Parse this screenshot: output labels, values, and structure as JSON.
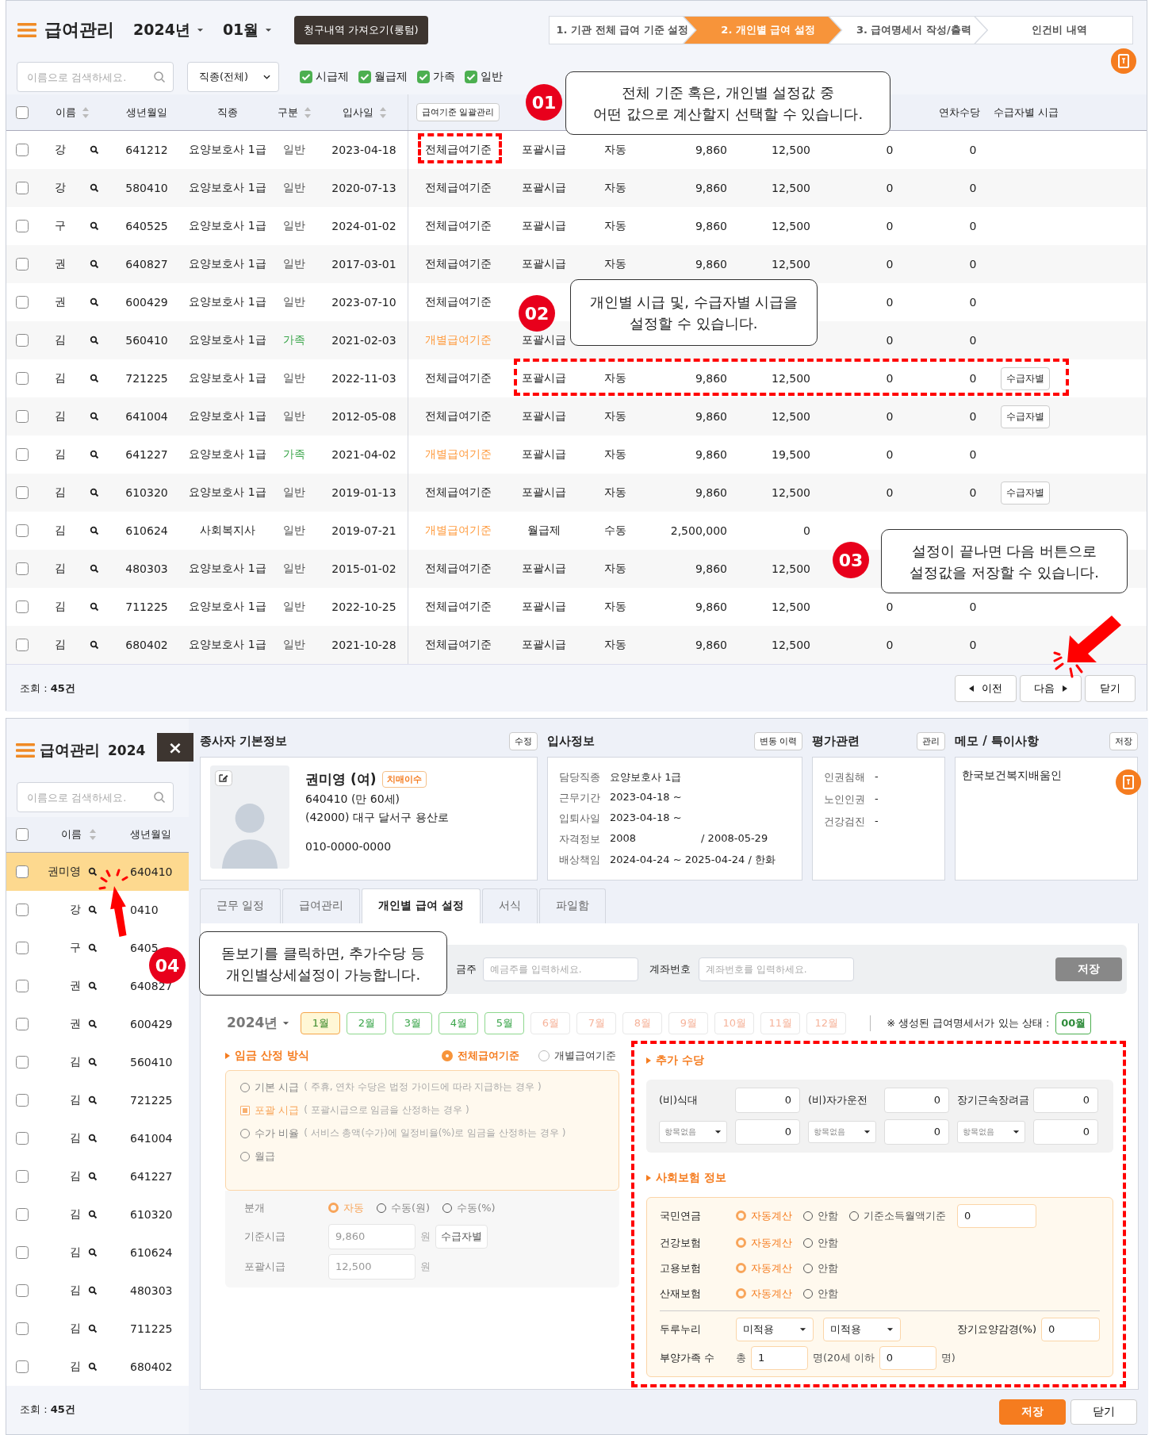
{
  "top": {
    "app_title": "급여관리",
    "year": "2024년",
    "month": "01월",
    "import_button": "청구내역 가져오기(롱텀)",
    "steps": [
      {
        "label": "1. 기관 전체 급여 기준 설정",
        "selected": false
      },
      {
        "label": "2. 개인별 급여 설정",
        "selected": true
      },
      {
        "label": "3. 급여명세서 작성/출력",
        "selected": false
      },
      {
        "label": "인건비 내역",
        "selected": false
      }
    ],
    "search": {
      "placeholder": "이름으로 검색하세요."
    },
    "job_select": "직종(전체)",
    "filters": [
      {
        "label": "시급제",
        "checked": true
      },
      {
        "label": "월급제",
        "checked": true
      },
      {
        "label": "가족",
        "checked": true
      },
      {
        "label": "일반",
        "checked": true
      }
    ],
    "select_all_checked": false,
    "columns": [
      {
        "kind": "text",
        "label": "이름",
        "sortable": true
      },
      {
        "kind": "text",
        "label": "생년월일"
      },
      {
        "kind": "text",
        "label": "직종"
      },
      {
        "kind": "text",
        "label": "구분",
        "sortable": true
      },
      {
        "kind": "text",
        "label": "입사일",
        "sortable": true
      },
      {
        "kind": "button",
        "label": "급여기준 일괄관리"
      },
      {
        "kind": "hidden"
      },
      {
        "kind": "hidden"
      },
      {
        "kind": "hidden"
      },
      {
        "kind": "hidden"
      },
      {
        "kind": "hidden"
      },
      {
        "kind": "text",
        "label": "연차수당"
      },
      {
        "kind": "text",
        "label": "수급자별 시급"
      }
    ],
    "rows": [
      {
        "checked": false,
        "name": "강",
        "birth": "641212",
        "job": "요양보호사 1급",
        "type": {
          "text": "일반",
          "color": "#555555"
        },
        "hired": "2023-04-18",
        "basis": {
          "text": "전체급여기준",
          "color": "#222222"
        },
        "method": "포괄시급",
        "mode": "자동",
        "column_10": "9,860",
        "column_11": "12,500",
        "column_12": "0",
        "annual_leave": "0"
      },
      {
        "checked": false,
        "name": "강",
        "birth": "580410",
        "job": "요양보호사 1급",
        "type": {
          "text": "일반",
          "color": "#555555"
        },
        "hired": "2020-07-13",
        "basis": {
          "text": "전체급여기준",
          "color": "#222222"
        },
        "method": "포괄시급",
        "mode": "자동",
        "column_10": "9,860",
        "column_11": "12,500",
        "column_12": "0",
        "annual_leave": "0"
      },
      {
        "checked": false,
        "name": "구",
        "birth": "640525",
        "job": "요양보호사 1급",
        "type": {
          "text": "일반",
          "color": "#555555"
        },
        "hired": "2024-01-02",
        "basis": {
          "text": "전체급여기준",
          "color": "#222222"
        },
        "method": "포괄시급",
        "mode": "자동",
        "column_10": "9,860",
        "column_11": "12,500",
        "column_12": "0",
        "annual_leave": "0"
      },
      {
        "checked": false,
        "name": "권",
        "birth": "640827",
        "job": "요양보호사 1급",
        "type": {
          "text": "일반",
          "color": "#555555"
        },
        "hired": "2017-03-01",
        "basis": {
          "text": "전체급여기준",
          "color": "#222222"
        },
        "method": "포괄시급",
        "mode": "자동",
        "column_10": "9,860",
        "column_11": "12,500",
        "column_12": "0",
        "annual_leave": "0"
      },
      {
        "checked": false,
        "name": "권",
        "birth": "600429",
        "job": "요양보호사 1급",
        "type": {
          "text": "일반",
          "color": "#555555"
        },
        "hired": "2023-07-10",
        "basis": {
          "text": "전체급여기준",
          "color": "#222222"
        },
        "column_12": "0",
        "annual_leave": "0"
      },
      {
        "checked": false,
        "name": "김",
        "birth": "560410",
        "job": "요양보호사 1급",
        "type": {
          "text": "가족",
          "color": "#3aa54a"
        },
        "hired": "2021-02-03",
        "basis": {
          "text": "개별급여기준",
          "color": "#ff9a3c"
        },
        "method": "포괄시급",
        "column_12": "0",
        "annual_leave": "0"
      },
      {
        "checked": false,
        "name": "김",
        "birth": "721225",
        "job": "요양보호사 1급",
        "type": {
          "text": "일반",
          "color": "#555555"
        },
        "hired": "2022-11-03",
        "basis": {
          "text": "전체급여기준",
          "color": "#222222"
        },
        "method": "포괄시급",
        "mode": "자동",
        "column_10": "9,860",
        "column_11": "12,500",
        "column_12": "0",
        "annual_leave": "0",
        "rate_button": "수급자별"
      },
      {
        "checked": false,
        "name": "김",
        "birth": "641004",
        "job": "요양보호사 1급",
        "type": {
          "text": "일반",
          "color": "#555555"
        },
        "hired": "2012-05-08",
        "basis": {
          "text": "전체급여기준",
          "color": "#222222"
        },
        "method": "포괄시급",
        "mode": "자동",
        "column_10": "9,860",
        "column_11": "12,500",
        "column_12": "0",
        "annual_leave": "0",
        "rate_button": "수급자별"
      },
      {
        "checked": false,
        "name": "김",
        "birth": "641227",
        "job": "요양보호사 1급",
        "type": {
          "text": "가족",
          "color": "#3aa54a"
        },
        "hired": "2021-04-02",
        "basis": {
          "text": "개별급여기준",
          "color": "#ff9a3c"
        },
        "method": "포괄시급",
        "mode": "자동",
        "column_10": "9,860",
        "column_11": "19,500",
        "column_12": "0",
        "annual_leave": "0"
      },
      {
        "checked": false,
        "name": "김",
        "birth": "610320",
        "job": "요양보호사 1급",
        "type": {
          "text": "일반",
          "color": "#555555"
        },
        "hired": "2019-01-13",
        "basis": {
          "text": "전체급여기준",
          "color": "#222222"
        },
        "method": "포괄시급",
        "mode": "자동",
        "column_10": "9,860",
        "column_11": "12,500",
        "column_12": "0",
        "annual_leave": "0",
        "rate_button": "수급자별"
      },
      {
        "checked": false,
        "name": "김",
        "birth": "610624",
        "job": "사회복지사",
        "type": {
          "text": "일반",
          "color": "#555555"
        },
        "hired": "2019-07-21",
        "basis": {
          "text": "개별급여기준",
          "color": "#ff9a3c"
        },
        "method": "월급제",
        "mode": "수동",
        "column_10": "2,500,000",
        "column_11": "0"
      },
      {
        "checked": false,
        "name": "김",
        "birth": "480303",
        "job": "요양보호사 1급",
        "type": {
          "text": "일반",
          "color": "#555555"
        },
        "hired": "2015-01-02",
        "basis": {
          "text": "전체급여기준",
          "color": "#222222"
        },
        "method": "포괄시급",
        "mode": "자동",
        "column_10": "9,860",
        "column_11": "12,500"
      },
      {
        "checked": false,
        "name": "김",
        "birth": "711225",
        "job": "요양보호사 1급",
        "type": {
          "text": "일반",
          "color": "#555555"
        },
        "hired": "2022-10-25",
        "basis": {
          "text": "전체급여기준",
          "color": "#222222"
        },
        "method": "포괄시급",
        "mode": "자동",
        "column_10": "9,860",
        "column_11": "12,500",
        "column_12": "0",
        "annual_leave": "0"
      },
      {
        "checked": false,
        "name": "김",
        "birth": "680402",
        "job": "요양보호사 1급",
        "type": {
          "text": "일반",
          "color": "#555555"
        },
        "hired": "2021-10-28",
        "basis": {
          "text": "전체급여기준",
          "color": "#222222"
        },
        "method": "포괄시급",
        "mode": "자동",
        "column_10": "9,860",
        "column_11": "12,500",
        "column_12": "0",
        "annual_leave": "0"
      }
    ],
    "count": "조회 : **45건**",
    "buttons": [
      {
        "label": "이전",
        "kind": "prev"
      },
      {
        "label": "다음",
        "kind": "next"
      },
      {
        "label": "닫기",
        "kind": "plain"
      }
    ]
  },
  "detail": {
    "sidebar": {
      "app_title": "급여관리",
      "year": "2024",
      "search": {
        "placeholder": "이름으로 검색하세요."
      },
      "select_all_checked": false,
      "columns": [
        {
          "label": "이름",
          "sortable": true
        },
        {
          "label": "생년월일"
        }
      ],
      "rows": [
        {
          "name": "권미영",
          "birth": "640410",
          "selected": true,
          "checked": false
        },
        {
          "name": "강",
          "birth": "0410",
          "selected": false,
          "checked": false
        },
        {
          "name": "구",
          "birth": "6405",
          "selected": false,
          "checked": false
        },
        {
          "name": "권",
          "birth": "640827",
          "selected": false,
          "checked": false
        },
        {
          "name": "권",
          "birth": "600429",
          "selected": false,
          "checked": false
        },
        {
          "name": "김",
          "birth": "560410",
          "selected": false,
          "checked": false
        },
        {
          "name": "김",
          "birth": "721225",
          "selected": false,
          "checked": false
        },
        {
          "name": "김",
          "birth": "641004",
          "selected": false,
          "checked": false
        },
        {
          "name": "김",
          "birth": "641227",
          "selected": false,
          "checked": false
        },
        {
          "name": "김",
          "birth": "610320",
          "selected": false,
          "checked": false
        },
        {
          "name": "김",
          "birth": "610624",
          "selected": false,
          "checked": false
        },
        {
          "name": "김",
          "birth": "480303",
          "selected": false,
          "checked": false
        },
        {
          "name": "김",
          "birth": "711225",
          "selected": false,
          "checked": false
        },
        {
          "name": "김",
          "birth": "680402",
          "selected": false,
          "checked": false
        }
      ],
      "count": "조회 : **45건**"
    },
    "close_button": "×",
    "sections": [
      {
        "title": "종사자 기본정보",
        "button": "수정"
      },
      {
        "title": "입사정보",
        "button": "변동 이력"
      },
      {
        "title": "평가관련",
        "button": "관리"
      },
      {
        "title": "메모 / 특이사항",
        "button": "저장"
      }
    ],
    "profile": {
      "name": "권미영 (여)",
      "badge": "치매이수",
      "birth": "640410 (만 60세)",
      "address": "(42000) 대구 달서구 용산로",
      "phone": "010-0000-0000"
    },
    "employment": [
      {
        "label": "담당직종",
        "values": [
          "요양보호사 1급"
        ]
      },
      {
        "label": "근무기간",
        "values": [
          "2023-04-18 ~"
        ]
      },
      {
        "label": "입퇴사일",
        "values": [
          "2023-04-18 ~"
        ]
      },
      {
        "label": "자격정보",
        "values": [
          "2008",
          "/ 2008-05-29"
        ]
      },
      {
        "label": "배상책임",
        "values": [
          "2024-04-24 ~ 2025-04-24 / 한화"
        ]
      }
    ],
    "evaluation": [
      {
        "label": "인권침해",
        "value": "-"
      },
      {
        "label": "노인인권",
        "value": "-"
      },
      {
        "label": "건강검진",
        "value": "-"
      }
    ],
    "memo": "한국보건복지배움인",
    "tabs": [
      {
        "label": "근무 일정",
        "selected": false
      },
      {
        "label": "급여관리",
        "selected": false
      },
      {
        "label": "개인별 급여 설정",
        "selected": true
      },
      {
        "label": "서식",
        "selected": false
      },
      {
        "label": "파일함",
        "selected": false
      }
    ],
    "bank": {
      "holder_label": "금주",
      "holder_placeholder": "예금주를 입력하세요.",
      "account_label": "계좌번호",
      "account_placeholder": "계좌번호를 입력하세요.",
      "save_button": "저장"
    },
    "year": "2024년",
    "months": [
      {
        "label": "1월",
        "selected": true,
        "generated": true
      },
      {
        "label": "2월",
        "selected": false,
        "generated": true
      },
      {
        "label": "3월",
        "selected": false,
        "generated": true
      },
      {
        "label": "4월",
        "selected": false,
        "generated": true
      },
      {
        "label": "5월",
        "selected": false,
        "generated": true
      },
      {
        "label": "6월",
        "selected": false,
        "generated": false
      },
      {
        "label": "7월",
        "selected": false,
        "generated": false
      },
      {
        "label": "8월",
        "selected": false,
        "generated": false
      },
      {
        "label": "9월",
        "selected": false,
        "generated": false
      },
      {
        "label": "10월",
        "selected": false,
        "generated": false
      },
      {
        "label": "11월",
        "selected": false,
        "generated": false
      },
      {
        "label": "12월",
        "selected": false,
        "generated": false
      }
    ],
    "status_label": "※ 생성된 급여명세서가 있는 상태 :",
    "status_value": "00월",
    "wage": {
      "title": "임금 산정 방식",
      "basis": [
        {
          "label": "전체급여기준",
          "selected": true
        },
        {
          "label": "개별급여기준",
          "selected": false
        }
      ],
      "methods": [
        {
          "label": "기본 시급",
          "note": "( 주휴, 연차 수당은 법정 가이드에 따라 지급하는 경우 )",
          "selected": false
        },
        {
          "label": "포괄 시급",
          "note": "( 포괄시급으로 임금을 산정하는 경우 )",
          "selected": true
        },
        {
          "label": "수가 비율",
          "note": "( 서비스 총액(수가)에 일정비율(%)로 임금을 산정하는 경우 )",
          "selected": false
        },
        {
          "label": "월급",
          "selected": false
        }
      ],
      "split_label": "분개",
      "split_options": [
        {
          "label": "자동",
          "selected": true
        },
        {
          "label": "수동(원)",
          "selected": false
        },
        {
          "label": "수동(%)",
          "selected": false
        }
      ],
      "base_label": "기준시급",
      "base_value": "9,860",
      "base_unit": "원",
      "rate_button": "수급자별",
      "inclusive_label": "포괄시급",
      "inclusive_value": "12,500",
      "inclusive_unit": "원"
    },
    "allowances": {
      "title": "추가 수당",
      "fixed": [
        {
          "label": "(비)식대",
          "value": "0"
        },
        {
          "label": "(비)자가운전",
          "value": "0"
        },
        {
          "label": "장기근속장려금",
          "value": "0"
        }
      ],
      "custom": [
        {
          "select": "항목없음",
          "value": "0"
        },
        {
          "select": "항목없음",
          "value": "0"
        },
        {
          "select": "항목없음",
          "value": "0"
        }
      ]
    },
    "insurance": {
      "title": "사회보험 정보",
      "rows": [
        {
          "label": "국민연금",
          "options": [
            {
              "label": "자동계산",
              "selected": true
            },
            {
              "label": "안함",
              "selected": false
            },
            {
              "label": "기준소득월액기준",
              "selected": false
            }
          ],
          "value": "0"
        },
        {
          "label": "건강보험",
          "options": [
            {
              "label": "자동계산",
              "selected": true
            },
            {
              "label": "안함",
              "selected": false
            }
          ]
        },
        {
          "label": "고용보험",
          "options": [
            {
              "label": "자동계산",
              "selected": true
            },
            {
              "label": "안함",
              "selected": false
            }
          ]
        },
        {
          "label": "산재보험",
          "options": [
            {
              "label": "자동계산",
              "selected": true
            },
            {
              "label": "안함",
              "selected": false
            }
          ]
        }
      ],
      "durunuri_label": "두루누리",
      "durunuri_selects": [
        "미적용",
        "미적용"
      ],
      "ltc_label": "장기요양감경(%)",
      "ltc_value": "0",
      "dependents_label": "부양가족 수",
      "total_label": "총",
      "total_value": "1",
      "under20_label": "명(20세 이하",
      "under20_value": "0",
      "end_label": "명)"
    },
    "footer_buttons": [
      {
        "label": "저장",
        "kind": "primary"
      },
      {
        "label": "닫기",
        "kind": "plain"
      }
    ]
  },
  "callouts": [
    {
      "number": "01",
      "text": "전체 기준 혹은, 개인별 설정값 중\n어떤 값으로 계산할지 선택할 수 있습니다."
    },
    {
      "number": "02",
      "text": "개인별 시급 및, 수급자별 시급을\n설정할 수 있습니다."
    },
    {
      "number": "03",
      "text": "설정이 끝나면 다음 버튼으로\n설정값을 저장할 수 있습니다."
    },
    {
      "number": "04",
      "text": "돋보기를 클릭하면, 추가수당 등\n개인별상세설정이 가능합니다."
    }
  ]
}
